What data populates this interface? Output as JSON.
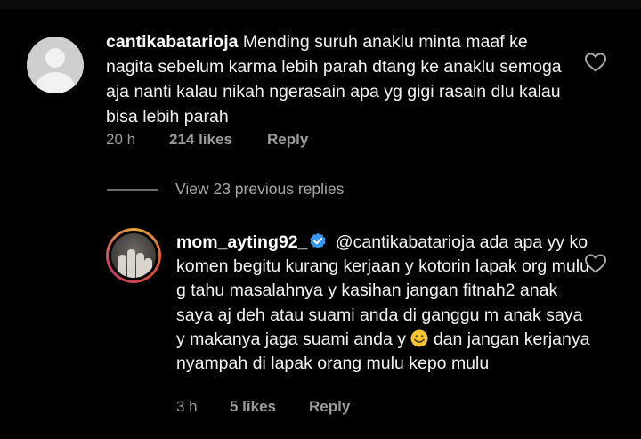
{
  "comment_1": {
    "username": "cantikabatarioja",
    "text": "Mending suruh anaklu minta maaf ke nagita sebelum karma lebih parah dtang ke anaklu semoga aja nanti kalau nikah ngerasain apa yg gigi rasain dlu kalau bisa lebih parah",
    "time": "20 h",
    "likes": "214 likes",
    "reply_label": "Reply",
    "avatar_icon": "default-avatar-icon",
    "like_icon": "heart-outline-icon"
  },
  "view_replies": {
    "label": "View 23 previous replies"
  },
  "comment_2": {
    "username": "mom_ayting92_",
    "verified_icon": "verified-badge-icon",
    "mention": "@cantikabatarioja",
    "text_before_emoji": "ada apa yy ko komen begitu kurang kerjaan y  kotorin lapak org mulu g tahu masalahnya y kasihan jangan fitnah2 anak saya aj deh atau suami anda di ganggu m anak saya y makanya jaga suami anda y",
    "emoji_icon": "smiling-face-emoji-icon",
    "text_after_emoji": "dan jangan kerjanya nyampah di lapak orang mulu kepo mulu",
    "time": "3 h",
    "likes": "5 likes",
    "reply_label": "Reply",
    "like_icon": "heart-outline-icon"
  },
  "colors": {
    "background": "#000000",
    "text_primary": "#f2f2f2",
    "text_secondary": "#9a9a9a",
    "verified_blue": "#3897f0",
    "story_ring": "#d8502d"
  }
}
